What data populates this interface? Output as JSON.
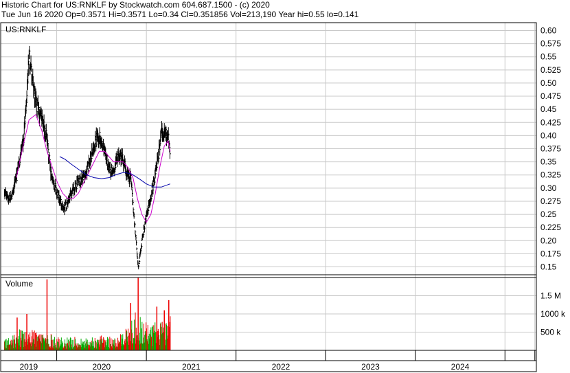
{
  "header": {
    "line1": "Historic Chart for US:RNKLF by Stockwatch.com 604.687.1500 - (c) 2020",
    "line2": "Tue Jun 16 2020  Op=0.3571  Hi=0.3571  Lo=0.34  Cl=0.351856  Vol=213,190  Year hi=0.55  lo=0.141"
  },
  "chart_data": {
    "type": "line",
    "symbol_label": "US:RNKLF",
    "price_axis": {
      "ticks": [
        "0.60",
        "0.575",
        "0.55",
        "0.525",
        "0.50",
        "0.475",
        "0.45",
        "0.425",
        "0.40",
        "0.375",
        "0.35",
        "0.325",
        "0.30",
        "0.275",
        "0.25",
        "0.225",
        "0.20",
        "0.175",
        "0.15"
      ],
      "range": [
        0.135,
        0.615
      ]
    },
    "volume_axis": {
      "label": "Volume",
      "ticks": [
        {
          "label": "1.5 M",
          "value": 1500000
        },
        {
          "label": "1000 k",
          "value": 1000000
        },
        {
          "label": "500 k",
          "value": 500000
        }
      ],
      "range": [
        0,
        2000000
      ]
    },
    "x_axis": {
      "years": [
        "2019",
        "2020",
        "2021",
        "2022",
        "2023",
        "2024"
      ],
      "year_boundaries_month_index": [
        7,
        19,
        31,
        43,
        55,
        67,
        71
      ],
      "range_month_index": [
        -0.5,
        71.2
      ]
    },
    "price_keypoints": [
      {
        "m": 0.0,
        "p": 0.29
      },
      {
        "m": 0.8,
        "p": 0.28
      },
      {
        "m": 1.6,
        "p": 0.32
      },
      {
        "m": 2.6,
        "p": 0.4
      },
      {
        "m": 3.3,
        "p": 0.55
      },
      {
        "m": 4.2,
        "p": 0.46
      },
      {
        "m": 5.0,
        "p": 0.43
      },
      {
        "m": 5.6,
        "p": 0.4
      },
      {
        "m": 6.2,
        "p": 0.33
      },
      {
        "m": 6.8,
        "p": 0.3
      },
      {
        "m": 7.3,
        "p": 0.28
      },
      {
        "m": 7.9,
        "p": 0.26
      },
      {
        "m": 8.4,
        "p": 0.27
      },
      {
        "m": 9.0,
        "p": 0.29
      },
      {
        "m": 9.8,
        "p": 0.31
      },
      {
        "m": 10.5,
        "p": 0.32
      },
      {
        "m": 11.2,
        "p": 0.34
      },
      {
        "m": 12.1,
        "p": 0.39
      },
      {
        "m": 12.8,
        "p": 0.4
      },
      {
        "m": 13.4,
        "p": 0.37
      },
      {
        "m": 14.0,
        "p": 0.34
      },
      {
        "m": 14.6,
        "p": 0.33
      },
      {
        "m": 15.1,
        "p": 0.36
      },
      {
        "m": 15.7,
        "p": 0.36
      },
      {
        "m": 16.3,
        "p": 0.33
      },
      {
        "m": 16.9,
        "p": 0.32
      },
      {
        "m": 17.5,
        "p": 0.22
      },
      {
        "m": 17.9,
        "p": 0.15
      },
      {
        "m": 18.3,
        "p": 0.19
      },
      {
        "m": 18.9,
        "p": 0.24
      },
      {
        "m": 19.5,
        "p": 0.28
      },
      {
        "m": 20.0,
        "p": 0.31
      },
      {
        "m": 20.6,
        "p": 0.36
      },
      {
        "m": 21.1,
        "p": 0.41
      },
      {
        "m": 21.6,
        "p": 0.4
      },
      {
        "m": 22.0,
        "p": 0.39
      },
      {
        "m": 22.2,
        "p": 0.35
      }
    ],
    "price_range_pct": 0.025,
    "ma_short": [
      {
        "m": 1.6,
        "p": 0.32
      },
      {
        "m": 2.5,
        "p": 0.38
      },
      {
        "m": 3.3,
        "p": 0.43
      },
      {
        "m": 4.2,
        "p": 0.44
      },
      {
        "m": 5.0,
        "p": 0.41
      },
      {
        "m": 5.7,
        "p": 0.37
      },
      {
        "m": 6.4,
        "p": 0.34
      },
      {
        "m": 7.1,
        "p": 0.31
      },
      {
        "m": 7.8,
        "p": 0.29
      },
      {
        "m": 8.5,
        "p": 0.28
      },
      {
        "m": 9.2,
        "p": 0.28
      },
      {
        "m": 9.9,
        "p": 0.29
      },
      {
        "m": 10.6,
        "p": 0.31
      },
      {
        "m": 11.3,
        "p": 0.33
      },
      {
        "m": 12.0,
        "p": 0.35
      },
      {
        "m": 12.7,
        "p": 0.37
      },
      {
        "m": 13.4,
        "p": 0.37
      },
      {
        "m": 14.0,
        "p": 0.36
      },
      {
        "m": 14.6,
        "p": 0.35
      },
      {
        "m": 15.2,
        "p": 0.35
      },
      {
        "m": 15.9,
        "p": 0.35
      },
      {
        "m": 16.5,
        "p": 0.34
      },
      {
        "m": 17.2,
        "p": 0.32
      },
      {
        "m": 17.8,
        "p": 0.28
      },
      {
        "m": 18.4,
        "p": 0.25
      },
      {
        "m": 19.0,
        "p": 0.235
      },
      {
        "m": 19.6,
        "p": 0.25
      },
      {
        "m": 20.2,
        "p": 0.29
      },
      {
        "m": 20.8,
        "p": 0.34
      },
      {
        "m": 21.4,
        "p": 0.38
      },
      {
        "m": 21.9,
        "p": 0.39
      },
      {
        "m": 22.2,
        "p": 0.37
      }
    ],
    "ma_long": [
      {
        "m": 7.4,
        "p": 0.36
      },
      {
        "m": 8.1,
        "p": 0.355
      },
      {
        "m": 9.0,
        "p": 0.345
      },
      {
        "m": 10.0,
        "p": 0.335
      },
      {
        "m": 11.0,
        "p": 0.325
      },
      {
        "m": 12.0,
        "p": 0.32
      },
      {
        "m": 13.0,
        "p": 0.318
      },
      {
        "m": 14.0,
        "p": 0.32
      },
      {
        "m": 15.0,
        "p": 0.326
      },
      {
        "m": 16.0,
        "p": 0.33
      },
      {
        "m": 17.0,
        "p": 0.327
      },
      {
        "m": 18.0,
        "p": 0.318
      },
      {
        "m": 19.0,
        "p": 0.308
      },
      {
        "m": 20.0,
        "p": 0.302
      },
      {
        "m": 21.0,
        "p": 0.302
      },
      {
        "m": 22.2,
        "p": 0.308
      }
    ],
    "volume_keypoints": [
      {
        "m": 0.0,
        "v": 250000
      },
      {
        "m": 1.5,
        "v": 350000
      },
      {
        "m": 2.5,
        "v": 600000
      },
      {
        "m": 3.5,
        "v": 500000
      },
      {
        "m": 4.5,
        "v": 450000
      },
      {
        "m": 5.5,
        "v": 400000
      },
      {
        "m": 6.5,
        "v": 350000
      },
      {
        "m": 7.5,
        "v": 300000
      },
      {
        "m": 8.5,
        "v": 280000
      },
      {
        "m": 9.5,
        "v": 300000
      },
      {
        "m": 10.5,
        "v": 280000
      },
      {
        "m": 11.5,
        "v": 300000
      },
      {
        "m": 12.5,
        "v": 330000
      },
      {
        "m": 13.5,
        "v": 320000
      },
      {
        "m": 14.5,
        "v": 300000
      },
      {
        "m": 15.5,
        "v": 350000
      },
      {
        "m": 16.5,
        "v": 600000
      },
      {
        "m": 17.5,
        "v": 900000
      },
      {
        "m": 18.5,
        "v": 700000
      },
      {
        "m": 19.5,
        "v": 600000
      },
      {
        "m": 20.5,
        "v": 650000
      },
      {
        "m": 21.5,
        "v": 700000
      },
      {
        "m": 22.2,
        "v": 800000
      }
    ],
    "volume_spikes": [
      {
        "m": 5.7,
        "v": 1950000
      },
      {
        "m": 17.9,
        "v": 2000000
      },
      {
        "m": 22.0,
        "v": 1380000
      },
      {
        "m": 16.9,
        "v": 1300000
      },
      {
        "m": 20.4,
        "v": 1200000
      },
      {
        "m": 21.4,
        "v": 1100000
      },
      {
        "m": 3.0,
        "v": 1000000
      },
      {
        "m": 1.7,
        "v": 900000
      }
    ],
    "colors": {
      "price": "#000000",
      "ma_short": "#cc00cc",
      "ma_long": "#0000aa",
      "volume_up": "#00aa00",
      "volume_down": "#ee0000",
      "grid": "#c8c8c8",
      "frame": "#000000"
    }
  }
}
